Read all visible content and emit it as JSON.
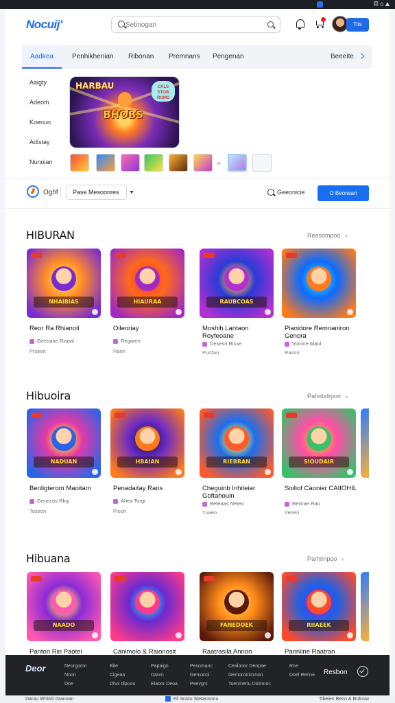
{
  "status_bar": {
    "text": "⚄ ⌂ ▲"
  },
  "header": {
    "logo": "Nocuij'",
    "search_placeholder": "Setinogan",
    "user_button": "Tits"
  },
  "tabs": [
    {
      "label": "Aadkea",
      "active": true
    },
    {
      "label": "Penhikhenian",
      "active": false
    },
    {
      "label": "Ribonan",
      "active": false
    },
    {
      "label": "Premnans",
      "active": false
    },
    {
      "label": "Pengenan",
      "active": false
    }
  ],
  "tabs_more": "Beeeite",
  "sidebar": [
    "Aaigty",
    "Adeom",
    "Koenun",
    "Adistay",
    "Nunoian"
  ],
  "hero": {
    "title": "HARBAU",
    "subtitle": "BHOBS",
    "badge": "CALS STOB ROMS"
  },
  "filters": {
    "label": "Oghf",
    "select_value": "Pase Mesoonres",
    "search_label": "Geeonicie",
    "button_label": "O Beonsan"
  },
  "sections": [
    {
      "title": "HIBURAN",
      "link": "Reasompoo",
      "link_arrow": "»",
      "cards": [
        {
          "band": "NHAIBIAS",
          "title": "Reor Ra Rhianoil",
          "meta": "Geeoane Risoal",
          "sub": "Prseen",
          "colors": [
            "#ff8d28",
            "#7a2cd0",
            "#ffd84a"
          ]
        },
        {
          "band": "HIAURAA",
          "title": "Oileoriay",
          "meta": "Regaren",
          "sub": "Raon",
          "colors": [
            "#ff6a1a",
            "#a12ac0",
            "#ff3a3a"
          ]
        },
        {
          "band": "RAUBCOAS",
          "title": "Moshih Lantaon Royfeoane",
          "meta": "Desesn Risse",
          "sub": "Purdan",
          "colors": [
            "#2a3bd8",
            "#b52fd0",
            "#ffb33a"
          ]
        },
        {
          "band": "",
          "title": "Pianidore Remnaniron Genora",
          "meta": "Vorone Maol",
          "sub": "Rasnn",
          "colors": [
            "#0d6bff",
            "#ff7a1a",
            "#31c6ff"
          ]
        }
      ]
    },
    {
      "title": "Hibuoira",
      "link": "Pahnbdrpon",
      "link_arrow": "»",
      "cards": [
        {
          "band": "NADUAN",
          "title": "Benligterom Maoitam",
          "meta": "Genecos Rbiy",
          "sub": "Toseon",
          "colors": [
            "#e23aa8",
            "#2a64e8",
            "#ffd030"
          ]
        },
        {
          "band": "HBAIAN",
          "title": "Penadaitay Rans",
          "meta": "Ahea Torgr",
          "sub": "Pioon",
          "colors": [
            "#6a2ac8",
            "#ff7a1a",
            "#22184a"
          ]
        },
        {
          "band": "RIEBRAN",
          "title": "Cheguinb Inhiteiar Goftahouin",
          "meta": "Beteaas Neteo",
          "sub": "Yuaeo",
          "colors": [
            "#1a6ff0",
            "#ff5a2a",
            "#ffe04a"
          ]
        },
        {
          "band": "SIOUDAIR",
          "title": "Soiliof Caonier CAIIOHIL",
          "meta": "Rertrae Rao",
          "sub": "Veoen",
          "colors": [
            "#ff4fa8",
            "#3ac06a",
            "#ffb030"
          ]
        }
      ]
    },
    {
      "title": "Hibuana",
      "link": "Parhimpoo",
      "link_arrow": "»",
      "cards": [
        {
          "band": "NAADO",
          "title": "Panton Rin Paotei",
          "meta": "",
          "sub": "",
          "colors": [
            "#8a2ad8",
            "#ff5ab0",
            "#ffd84a"
          ]
        },
        {
          "band": "",
          "title": "Canimolo & Raionosit",
          "meta": "",
          "sub": "",
          "colors": [
            "#6a2ad0",
            "#ff3a8a",
            "#24c0ff"
          ]
        },
        {
          "band": "FANEDOEK",
          "title": "Raatrasila Annon",
          "meta": "",
          "sub": "",
          "colors": [
            "#ff8a1a",
            "#5a1a0a",
            "#ffc640"
          ]
        },
        {
          "band": "RIIAEEK",
          "title": "Panniine Raatran",
          "meta": "",
          "sub": "",
          "colors": [
            "#1a62e8",
            "#ff4a2a",
            "#8a2ad0"
          ]
        }
      ]
    }
  ],
  "footer": {
    "logo": "Deor",
    "columns": [
      [
        "Neorgomn",
        "Nnon",
        "Doe"
      ],
      [
        "Bite",
        "Cigeaa",
        "Dhoi dipoou"
      ],
      [
        "Papaign",
        "Daom",
        "Elaoor Deoa"
      ],
      [
        "Pesomanc",
        "Gemonoi",
        "Peevgrs"
      ],
      [
        "Cealooor Deopae",
        "Gemorotrimmon",
        "Toenmeriu Dioinnoc"
      ],
      [
        "Rne",
        "Doel Rerine",
        ""
      ]
    ],
    "right_label": "Resbon"
  },
  "bottom_bar": {
    "left": "Darau Whiwit Gtanoan",
    "middle": "Fil Snotu Stetanoonu",
    "right": "Tibeien Benn & Rulnow"
  }
}
